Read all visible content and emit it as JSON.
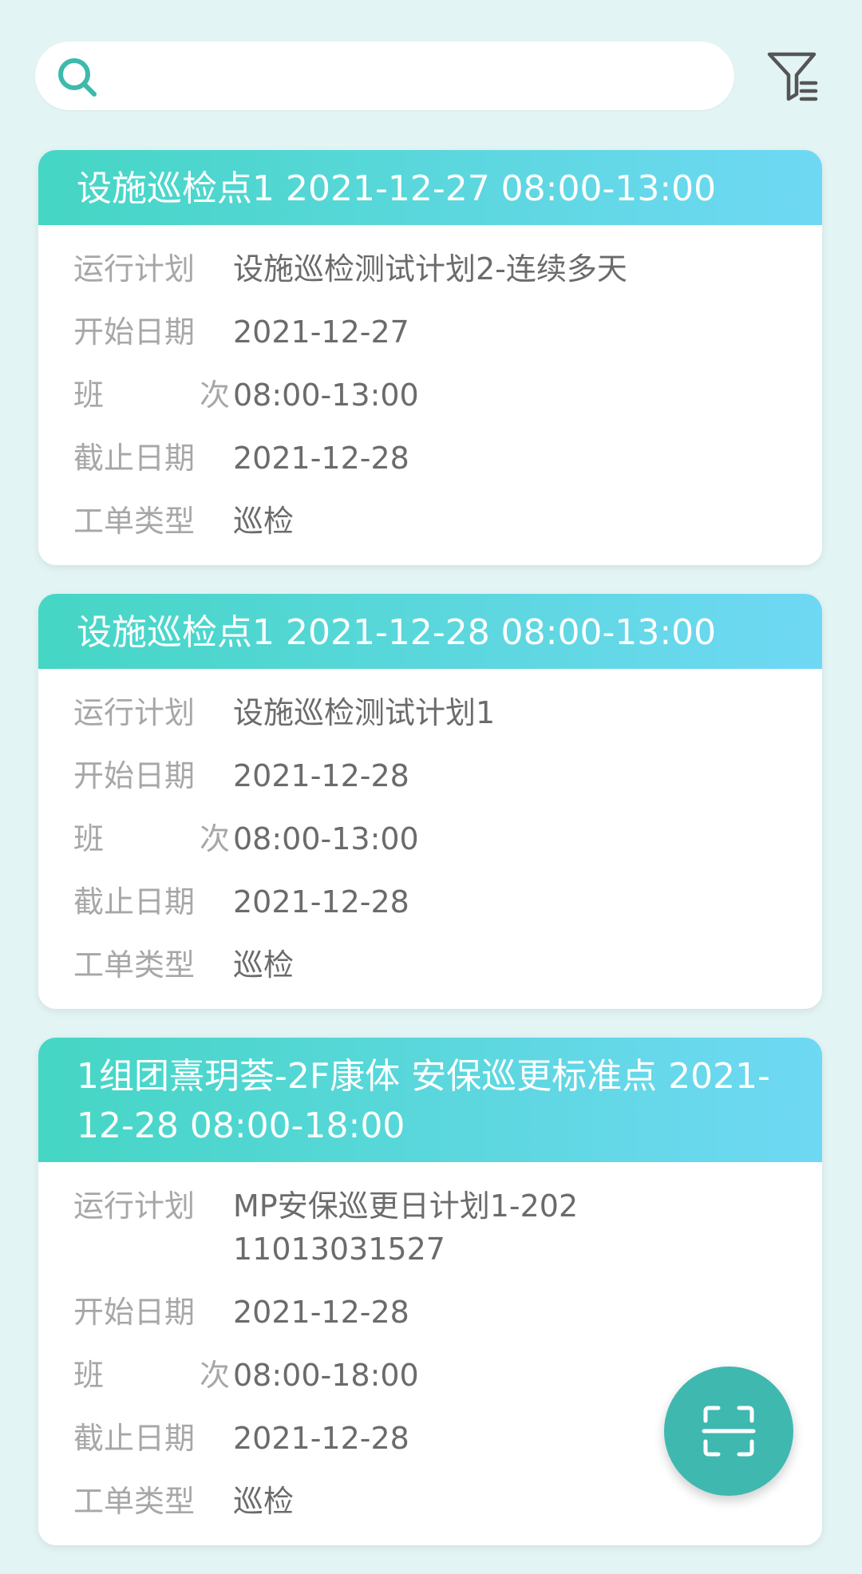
{
  "search": {
    "placeholder": ""
  },
  "labels": {
    "plan": "运行计划",
    "start": "开始日期",
    "shift_a": "班",
    "shift_b": "次",
    "deadline": "截止日期",
    "type": "工单类型"
  },
  "cards": [
    {
      "title": "设施巡检点1 2021-12-27 08:00-13:00",
      "plan": "设施巡检测试计划2-连续多天",
      "start": "2021-12-27",
      "shift": "08:00-13:00",
      "deadline": "2021-12-28",
      "type": "巡检"
    },
    {
      "title": "设施巡检点1 2021-12-28 08:00-13:00",
      "plan": "设施巡检测试计划1",
      "start": "2021-12-28",
      "shift": "08:00-13:00",
      "deadline": "2021-12-28",
      "type": "巡检"
    },
    {
      "title": "1组团熹玥荟-2F康体 安保巡更标准点 2021-12-28 08:00-18:00",
      "plan": "MP安保巡更日计划1-20211013031527",
      "start": "2021-12-28",
      "shift": "08:00-18:00",
      "deadline": "2021-12-28",
      "type": "巡检"
    }
  ],
  "colors": {
    "background": "#e3f4f4",
    "header_gradient_start": "#45d6c4",
    "header_gradient_end": "#6fd8f4",
    "accent": "#3fb8b0",
    "label": "#a7a7a7",
    "value": "#6b6b6b"
  },
  "icons": {
    "search": "search-icon",
    "filter": "filter-icon",
    "scan": "scan-icon"
  }
}
